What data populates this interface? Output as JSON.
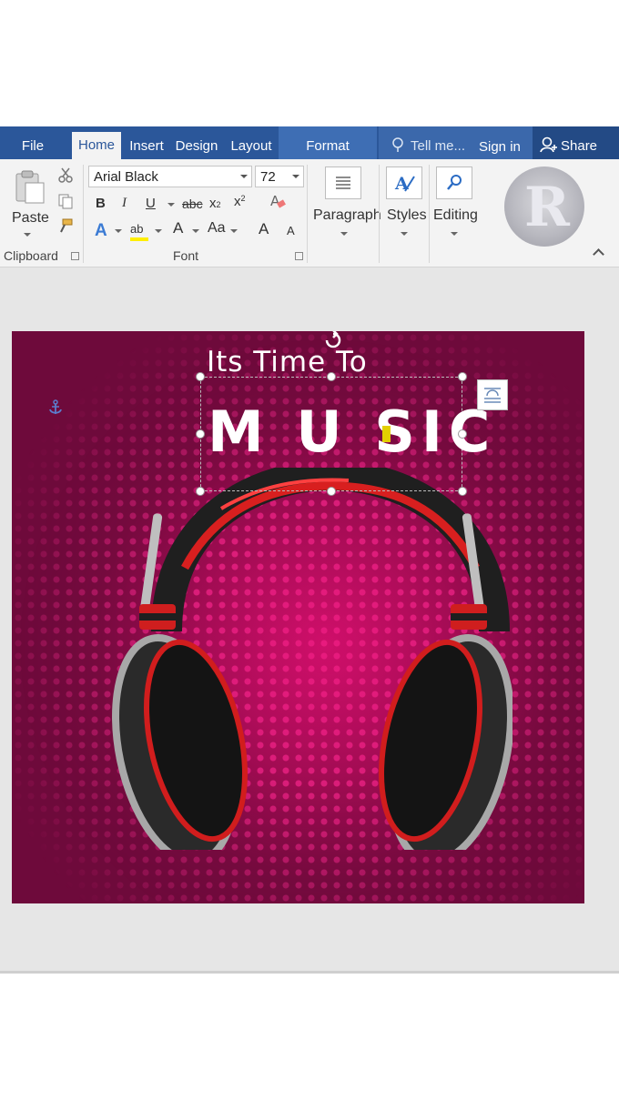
{
  "tabs": {
    "file": "File",
    "home": "Home",
    "insert": "Insert",
    "design": "Design",
    "layout": "Layout",
    "format": "Format"
  },
  "tell_me": "Tell me...",
  "sign_in": "Sign in",
  "share": "Share",
  "clipboard": {
    "paste": "Paste",
    "group_label": "Clipboard"
  },
  "font": {
    "name": "Arial Black",
    "size": "72",
    "group_label": "Font",
    "bold": "B",
    "italic": "I",
    "underline": "U",
    "strike": "abc",
    "sub": "x",
    "sub_small": "2",
    "sup": "x",
    "sup_small": "2",
    "text_effects": "A",
    "font_color": "A",
    "change_case": "Aa",
    "grow": "A",
    "shrink": "A",
    "highlight": "ab"
  },
  "groups": {
    "paragraph": "Paragraph",
    "styles": "Styles",
    "editing": "Editing"
  },
  "document": {
    "subtitle": "Its Time  To",
    "title": "M U SIC"
  },
  "colors": {
    "accent": "#2b579a",
    "page_bg": "#6e0a3b",
    "dots": "#f0288c"
  }
}
